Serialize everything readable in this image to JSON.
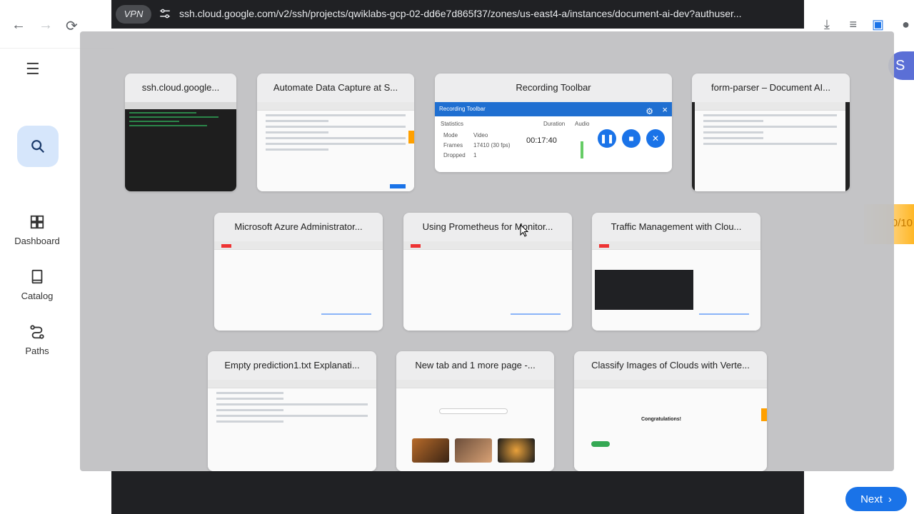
{
  "browser": {
    "url": "ssh.cloud.google.com/v2/ssh/projects/qwiklabs-gcp-02-dd6e7d865f37/zones/us-east4-a/instances/document-ai-dev?authuser...",
    "vpn_label": "VPN"
  },
  "sidebar": {
    "items": [
      {
        "label": "Dashboard",
        "icon": "dashboard-icon"
      },
      {
        "label": "Catalog",
        "icon": "book-icon"
      },
      {
        "label": "Paths",
        "icon": "route-icon"
      }
    ]
  },
  "right_panel": {
    "avatar_initial": "S",
    "progress_chip": "0/10",
    "next_label": "Next"
  },
  "overview": {
    "windows": [
      {
        "title": "ssh.cloud.google..."
      },
      {
        "title": "Automate Data Capture at S..."
      },
      {
        "title": "Recording Toolbar"
      },
      {
        "title": "form-parser – Document AI..."
      },
      {
        "title": "Microsoft Azure Administrator..."
      },
      {
        "title": "Using Prometheus for Monitor..."
      },
      {
        "title": "Traffic Management with Clou..."
      },
      {
        "title": "Empty prediction1.txt Explanati..."
      },
      {
        "title": "New tab and 1 more page -..."
      },
      {
        "title": "Classify Images of Clouds with Verte..."
      }
    ]
  },
  "recording_toolbar": {
    "header": "Recording Toolbar",
    "stats_heading": "Statistics",
    "duration_heading": "Duration",
    "audio_heading": "Audio",
    "mode_label": "Mode",
    "mode_value": "Video",
    "frames_label": "Frames",
    "frames_value": "17410 (30 fps)",
    "dropped_label": "Dropped",
    "dropped_value": "1",
    "duration_value": "00:17:40"
  },
  "classify_thumb": {
    "heading": "Congratulations!"
  }
}
